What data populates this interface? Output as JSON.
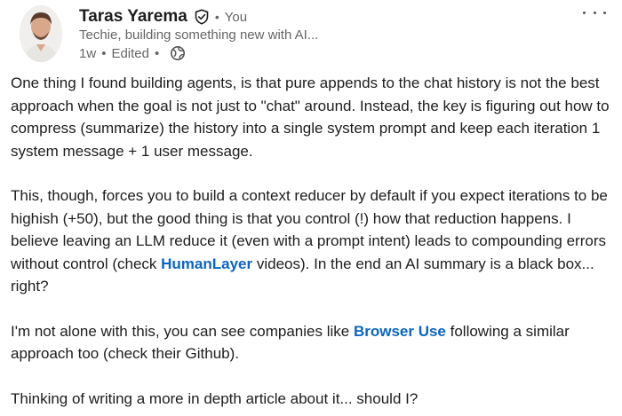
{
  "post": {
    "author": {
      "name": "Taras Yarema",
      "relation": "You",
      "headline": "Techie, building something new with AI...",
      "time": "1w",
      "edited": "Edited"
    },
    "paragraphs": [
      {
        "segments": [
          {
            "text": "One thing I found building agents, is that pure appends to the chat history is not the best approach when the goal is not just to \"chat\" around. Instead, the key is figuring out how to compress (summarize) the history into a single system prompt and keep each iteration 1 system message + 1 user message."
          }
        ]
      },
      {
        "segments": [
          {
            "text": "This, though, forces you to build a context reducer by default if you expect iterations to be highish (+50), but the good thing is that you control (!) how that reduction happens. I believe leaving an LLM reduce it (even with a prompt intent) leads to compounding errors without control (check "
          },
          {
            "text": "HumanLayer",
            "link": true
          },
          {
            "text": " videos). In the end an AI summary is a black box... right?"
          }
        ]
      },
      {
        "segments": [
          {
            "text": "I'm not alone with this, you can see companies like "
          },
          {
            "text": "Browser Use",
            "link": true
          },
          {
            "text": " following a similar approach too (check their Github)."
          }
        ]
      },
      {
        "segments": [
          {
            "text": "Thinking of writing a more in depth article about it... should I?"
          }
        ]
      }
    ]
  },
  "colors": {
    "link": "#0a66c2",
    "text": "#1d1d1d",
    "muted": "#666666"
  },
  "icons": {
    "verify": "verified-shield-icon",
    "visibility": "globe-icon",
    "menu": "more-options-icon"
  }
}
